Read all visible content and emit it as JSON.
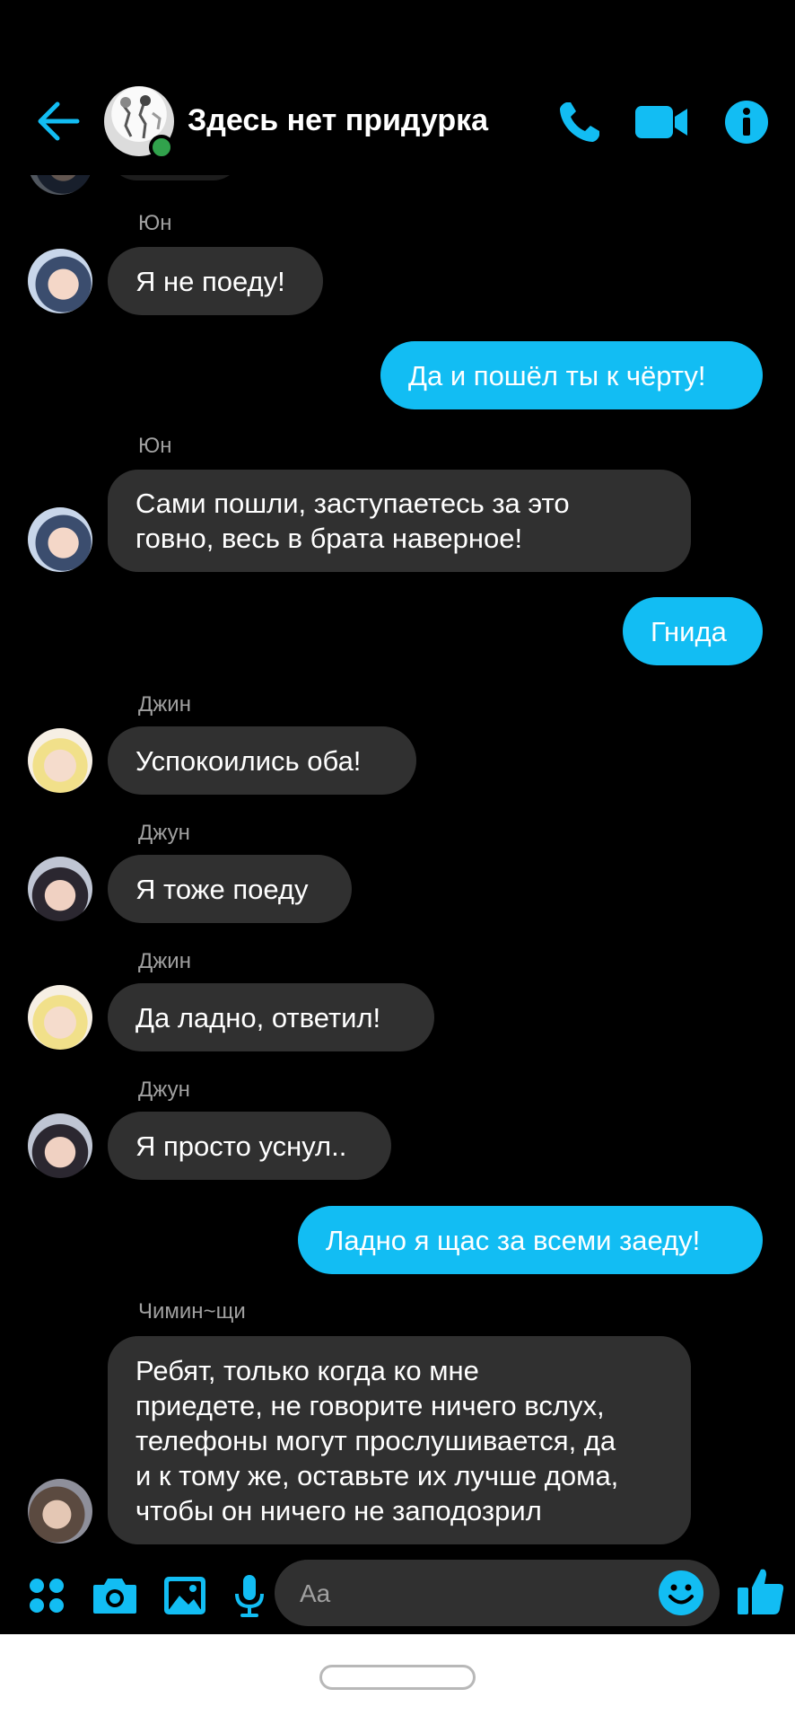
{
  "header": {
    "title": "Здесь нет придурка",
    "accent_color": "#12bdf3",
    "icons": [
      "back-arrow-icon",
      "phone-icon",
      "video-camera-icon",
      "info-icon"
    ]
  },
  "messages": [
    {
      "sender": "Юн",
      "text": "Я не поеду!",
      "outgoing": false
    },
    {
      "text": "Да и пошёл ты к чёрту!",
      "outgoing": true
    },
    {
      "sender": "Юн",
      "text": "Сами пошли, заступаетесь за это\nговно, весь в брата наверное!",
      "outgoing": false
    },
    {
      "text": "Гнида",
      "outgoing": true
    },
    {
      "sender": "Джин",
      "text": "Успокоились оба!",
      "outgoing": false
    },
    {
      "sender": "Джун",
      "text": "Я тоже поеду",
      "outgoing": false
    },
    {
      "sender": "Джин",
      "text": "Да ладно, ответил!",
      "outgoing": false
    },
    {
      "sender": "Джун",
      "text": "Я просто уснул..",
      "outgoing": false
    },
    {
      "text": "Ладно я щас за всеми заеду!",
      "outgoing": true
    },
    {
      "sender": "Чимин~щи",
      "text": "Ребят, только когда ко мне\nприедете, не говорите ничего вслух,\nтелефоны могут прослушивается, да\nи к тому же, оставьте их лучше дома,\nчтобы он ничего не заподозрил",
      "outgoing": false
    }
  ],
  "composer": {
    "placeholder": "Aa",
    "icons": [
      "apps-grid-icon",
      "camera-icon",
      "gallery-icon",
      "microphone-icon",
      "emoji-icon",
      "thumbs-up-icon"
    ]
  },
  "colors": {
    "background": "#000000",
    "incoming_bubble": "#303030",
    "outgoing_bubble": "#12bdf3",
    "online": "#31a24c"
  }
}
